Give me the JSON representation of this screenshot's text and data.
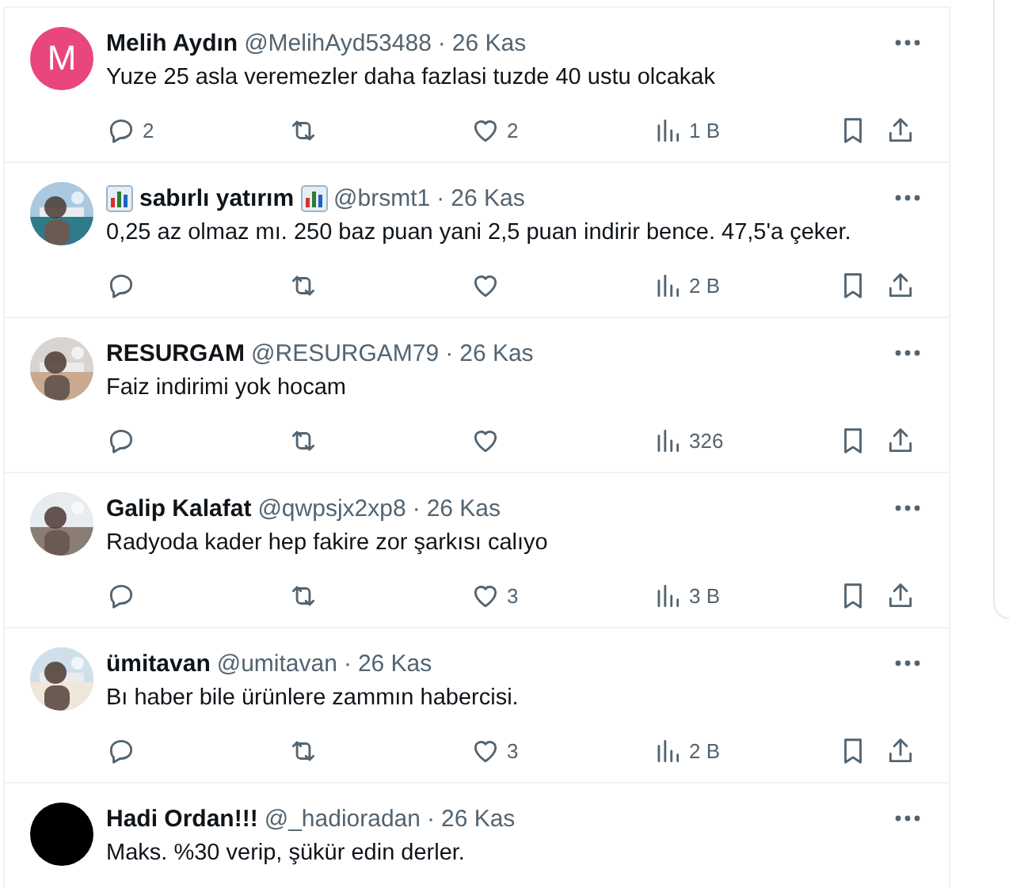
{
  "tweets": [
    {
      "avatar": {
        "kind": "letter",
        "letter": "M",
        "color": "#e8467c"
      },
      "name": "Melih Aydın",
      "name_badges": false,
      "handle": "@MelihAyd53488",
      "sep": "·",
      "time": "26 Kas",
      "text": "Yuze 25 asla veremezler daha fazlasi tuzde 40 ustu olcakak",
      "replies": "2",
      "likes": "2",
      "views": "1 B",
      "action_bar": true
    },
    {
      "name": "sabırlı yatırım",
      "name_badges": true,
      "handle": "@brsmt1",
      "sep": "·",
      "time": "26 Kas",
      "text": "0,25 az olmaz mı. 250 baz puan yani 2,5 puan indirir bence. 47,5'a çeker.",
      "views": "2 B",
      "action_bar": true
    },
    {
      "name": "RESURGAM",
      "name_badges": false,
      "handle": "@RESURGAM79",
      "sep": "·",
      "time": "26 Kas",
      "text": "Faiz indirimi yok hocam",
      "views": "326",
      "action_bar": true
    },
    {
      "name": "Galip Kalafat",
      "name_badges": false,
      "handle": "@qwpsjx2xp8",
      "sep": "·",
      "time": "26 Kas",
      "text": "Radyoda kader hep fakire zor şarkısı calıyo",
      "likes": "3",
      "views": "3 B",
      "action_bar": true
    },
    {
      "name": "ümitavan",
      "name_badges": false,
      "handle": "@umitavan",
      "sep": "·",
      "time": "26 Kas",
      "text": "Bı haber bile ürünlere zammın habercisi.",
      "likes": "3",
      "views": "2 B",
      "action_bar": true
    },
    {
      "avatar": {
        "kind": "plain",
        "color": "#000000"
      },
      "name": "Hadi Ordan!!!",
      "name_badges": false,
      "handle": "@_hadioradan",
      "sep": "·",
      "time": "26 Kas",
      "text": "Maks. %30 verip, şükür edin derler."
    }
  ]
}
